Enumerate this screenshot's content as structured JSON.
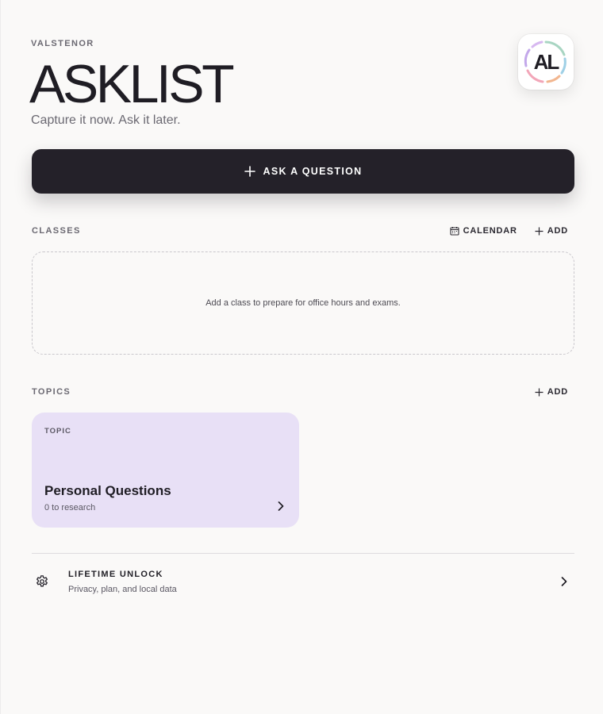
{
  "header": {
    "brand": "VALSTENOR",
    "title": "ASKLIST",
    "tagline": "Capture it now. Ask it later.",
    "logo_text": "AL",
    "logo_icon": "app-logo"
  },
  "primary_action": {
    "icon": "plus-icon",
    "label": "ASK A QUESTION"
  },
  "classes": {
    "title": "CLASSES",
    "calendar_label": "CALENDAR",
    "add_label": "ADD",
    "empty_text": "Add a class to prepare for office hours and exams."
  },
  "topics": {
    "title": "TOPICS",
    "add_label": "ADD",
    "items": [
      {
        "kicker": "TOPIC",
        "name": "Personal Questions",
        "subtitle": "0 to research",
        "color": "#e8e0f6"
      }
    ]
  },
  "settings": {
    "icon": "gear-icon",
    "title": "LIFETIME UNLOCK",
    "subtitle": "Privacy, plan, and local data"
  },
  "colors": {
    "background": "#faf9f8",
    "primary_button": "#242129",
    "topic_card": "#e8e0f6"
  }
}
